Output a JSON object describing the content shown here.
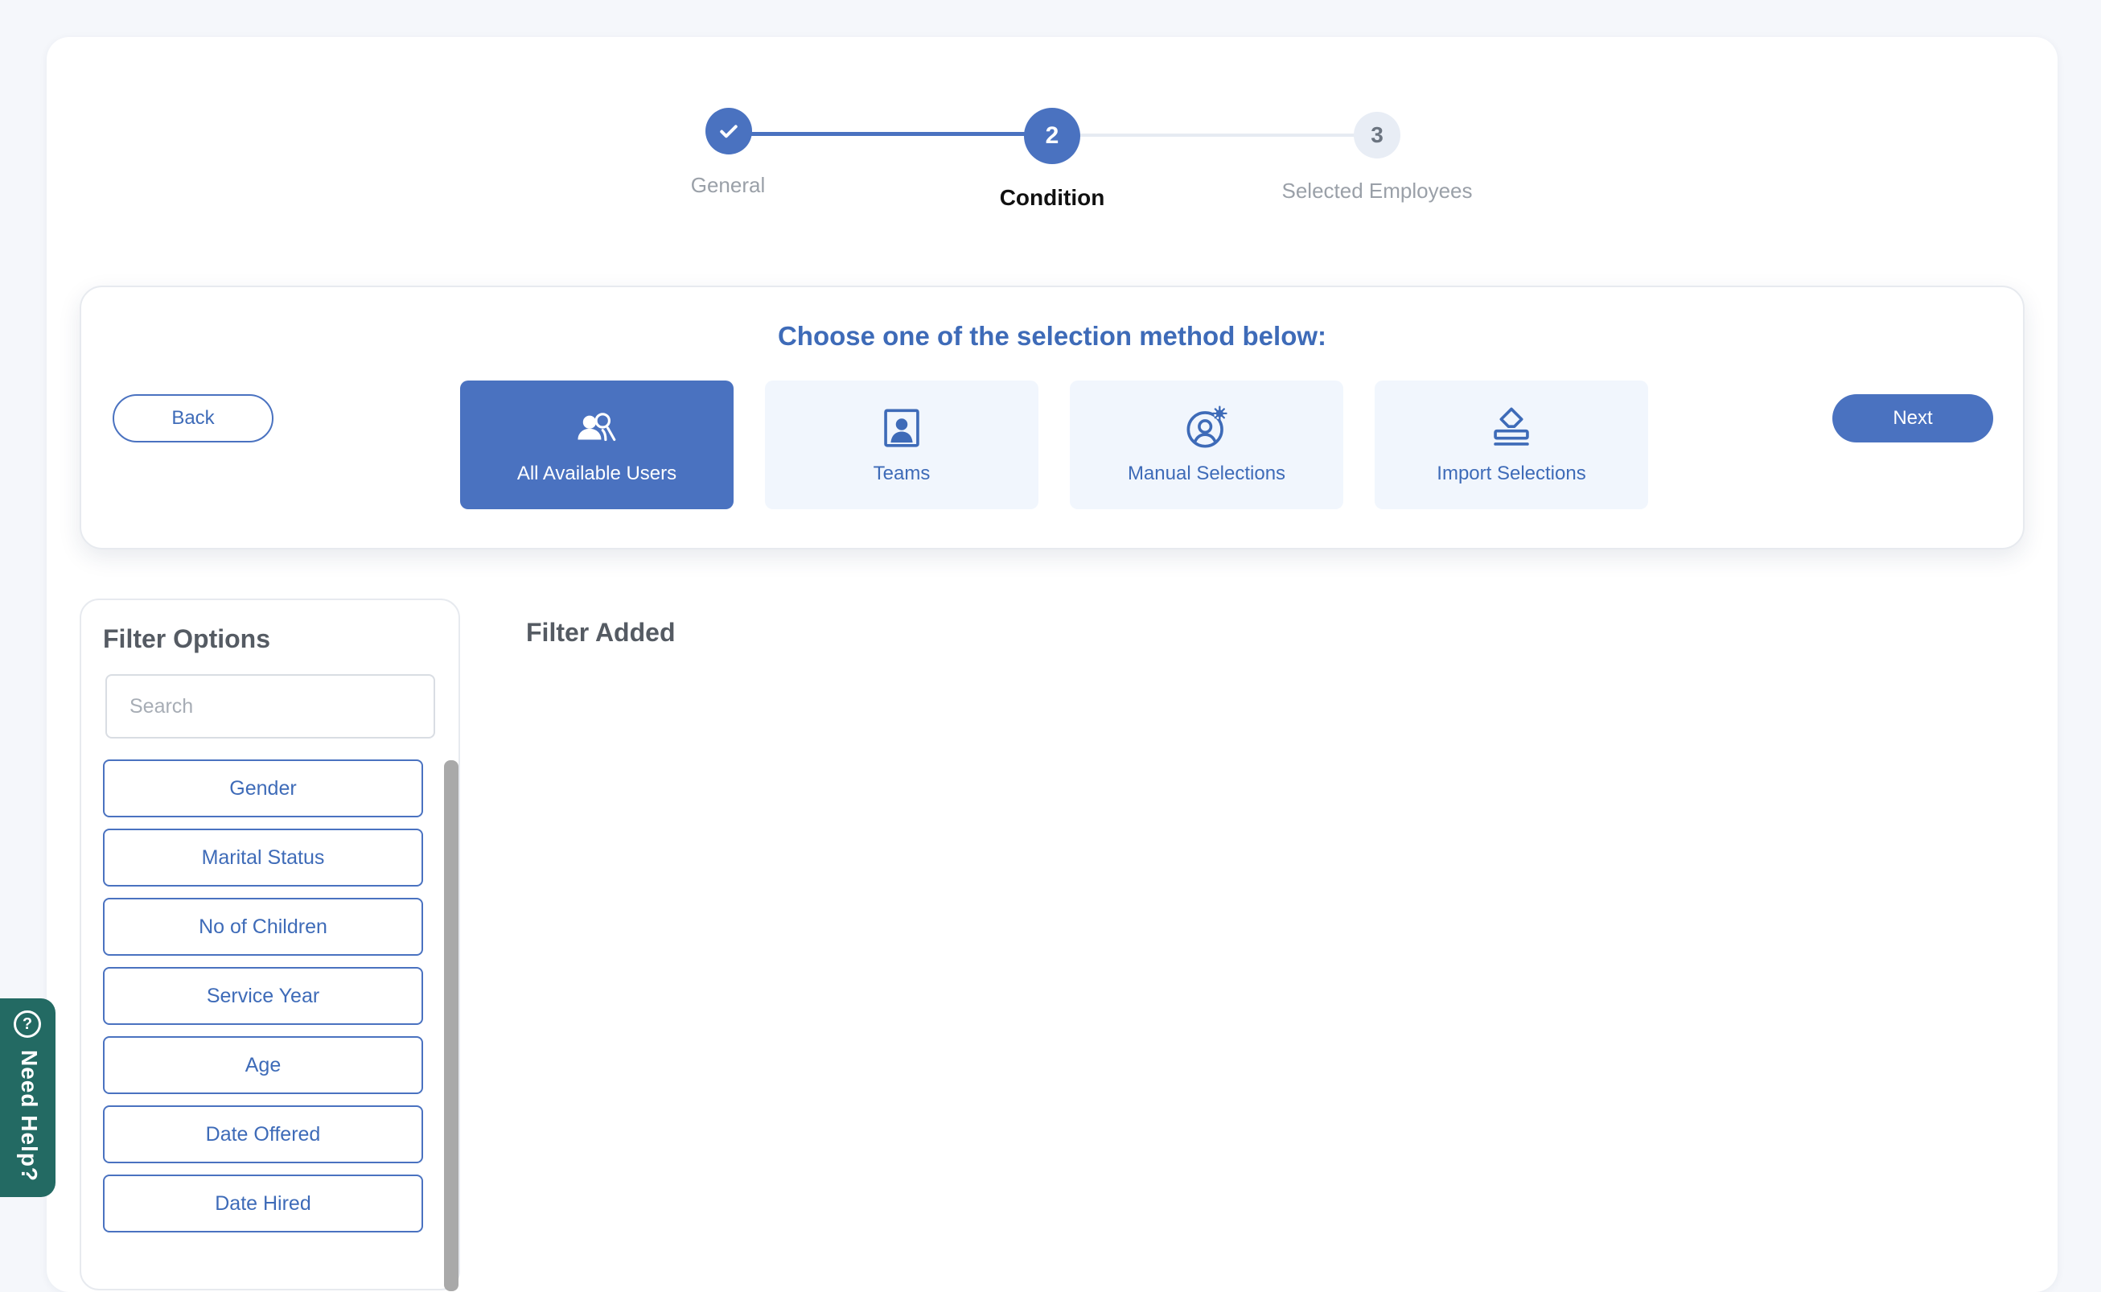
{
  "stepper": {
    "steps": [
      {
        "label": "General",
        "number": "",
        "state": "done"
      },
      {
        "label": "Condition",
        "number": "2",
        "state": "current"
      },
      {
        "label": "Selected Employees",
        "number": "3",
        "state": "pending"
      }
    ]
  },
  "selection": {
    "title": "Choose one of the selection method below:",
    "back_label": "Back",
    "next_label": "Next",
    "methods": [
      {
        "label": "All Available Users",
        "icon": "users-icon",
        "active": true
      },
      {
        "label": "Teams",
        "icon": "team-portrait-icon",
        "active": false
      },
      {
        "label": "Manual Selections",
        "icon": "user-gear-icon",
        "active": false
      },
      {
        "label": "Import Selections",
        "icon": "import-stamp-icon",
        "active": false
      }
    ]
  },
  "filters": {
    "title": "Filter Options",
    "search_placeholder": "Search",
    "options": [
      "Gender",
      "Marital Status",
      "No of Children",
      "Service Year",
      "Age",
      "Date Offered",
      "Date Hired"
    ]
  },
  "filter_added": {
    "title": "Filter Added"
  },
  "help": {
    "label": "Need Help?"
  },
  "colors": {
    "accent": "#4a72c0",
    "accent_text": "#3e6bb8",
    "help_tab": "#236a63"
  }
}
